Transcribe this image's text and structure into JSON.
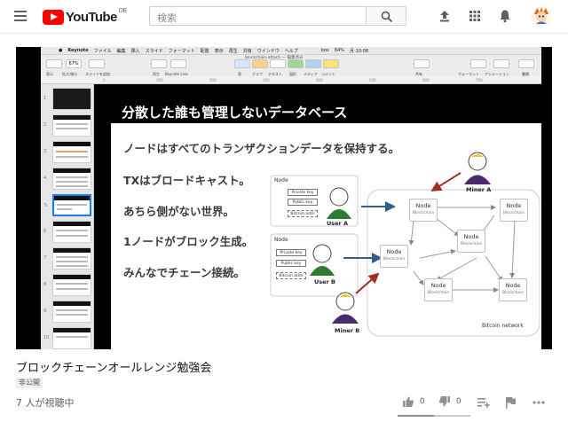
{
  "header": {
    "logo_text": "YouTube",
    "region": "DE",
    "search_placeholder": "検索"
  },
  "video": {
    "app_menubar": [
      "Keynote",
      "ファイル",
      "編集",
      "挿入",
      "スライド",
      "フォーマット",
      "配置",
      "表示",
      "再生",
      "共有",
      "ウインドウ",
      "ヘルプ"
    ],
    "menubar_status": [
      "box",
      "64%",
      "月 10:08"
    ],
    "window_title": "blockchain-attach — 編集済み",
    "toolbar_items": [
      "表示",
      "拡大/縮小",
      "スライドを追加",
      "再生",
      "Keynote Live",
      "表",
      "グラフ",
      "テキスト",
      "図形",
      "メディア",
      "コメント",
      "共有",
      "フォーマット",
      "アニメーション",
      "書類"
    ],
    "zoom": "67%",
    "slide_numbers": [
      "1",
      "2",
      "3",
      "4",
      "5",
      "6",
      "7",
      "8",
      "9",
      "10"
    ],
    "slide": {
      "title": "分散した誰も管理しないデータベース",
      "bullets": [
        "ノードはすべてのトランザクションデータを保持する。",
        "TXはブロードキャスト。",
        "あちら側がない世界。",
        "1ノードがブロック生成。",
        "みんなでチェーン接続。"
      ],
      "user_a": {
        "node_label": "Node",
        "keys": [
          "Private key",
          "Public key",
          "Bitcoin addr"
        ],
        "name": "User A"
      },
      "user_b": {
        "node_label": "Node",
        "keys": [
          "Private key",
          "Public key",
          "Bitcoin addr"
        ],
        "name": "User B"
      },
      "miner_a": "Miner A",
      "miner_b": "Miner B",
      "network_node": {
        "title": "Node",
        "sub": "Blockchain"
      },
      "network_label": "Bitcoin network"
    }
  },
  "info": {
    "title": "ブロックチェーンオールレンジ勉強会",
    "privacy_badge": "非公開",
    "viewers": "7 人が視聴中",
    "likes": "0",
    "dislikes": "0",
    "like_ratio": 0.5
  },
  "colors": {
    "brand_red": "#ff0000",
    "selection_blue": "#1a7df0",
    "user_green": "#2e7d32",
    "miner_purple": "#4a2a6a",
    "arrow_blue": "#2f5f8f",
    "arrow_red": "#9e3020"
  }
}
